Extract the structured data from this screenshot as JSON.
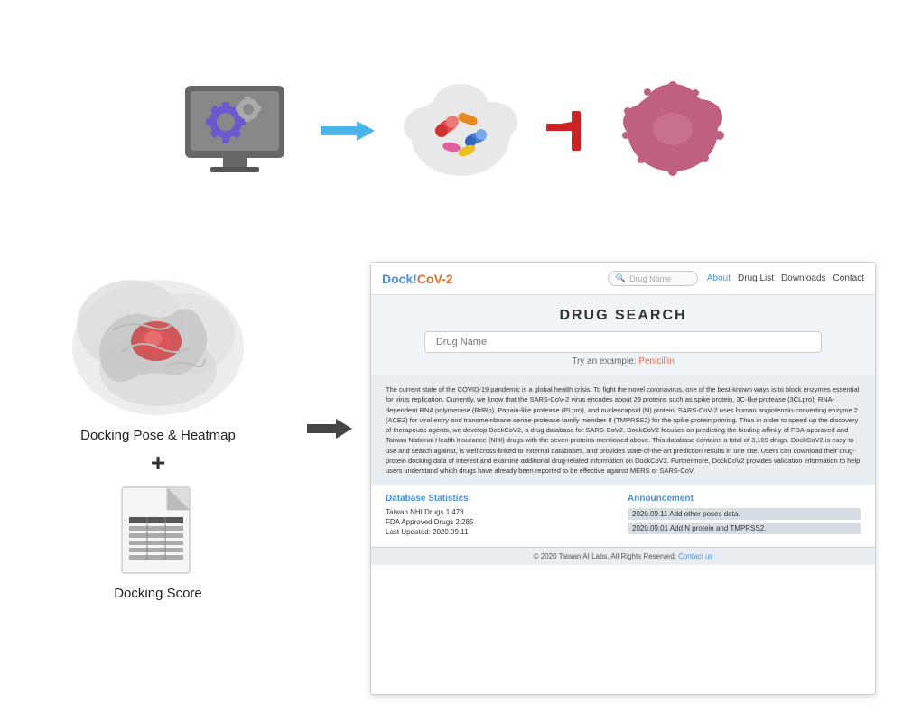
{
  "top": {
    "monitor_label": "Computer with gears",
    "pills_label": "Drug pills cloud",
    "virus_label": "Virus cloud",
    "arrow_label": "Arrow right",
    "block_label": "Block stop arrow"
  },
  "left_panel": {
    "docking_pose_label": "Docking Pose & Heatmap",
    "plus_sign": "+",
    "docking_score_label": "Docking Score"
  },
  "website": {
    "logo": "DockCoV-2",
    "logo_dock": "Dock",
    "logo_cov": "CoV-2",
    "search_placeholder": "Drug Name",
    "nav_links": [
      "About",
      "Drug List",
      "Downloads",
      "Contact"
    ],
    "drug_search_title": "DRUG SEARCH",
    "search_input_placeholder": "Drug Name",
    "try_example_text": "Try an example:",
    "try_example_link": "Penicillin",
    "description": "The current state of the COVID-19 pandemic is a global health crisis. To fight the novel coronavirus, one of the best-known ways is to block enzymes essential for virus replication. Currently, we know that the SARS-CoV-2 virus encodes about 29 proteins such as spike protein, 3C-like protease (3CLpro), RNA-dependent RNA polymerase (RdRp), Papain-like protease (PLpro), and nucleocapsid (N) protein. SARS-CoV-2 uses human angiotensin-converting enzyme 2 (ACE2) for viral entry and transmembrane serine protease family member II (TMPRSS2) for the spike protein priming. Thus in order to speed up the discovery of therapeutic agents, we develop DockCoV2, a drug database for SARS-CoV2. DockCoV2 focuses on predicting the binding affinity of FDA-approved and Taiwan National Health Insurance (NHI) drugs with the seven proteins mentioned above. This database contains a total of 3,109 drugs. DockCoV2 is easy to use and search against, is well cross-linked to external databases, and provides state-of-the-art prediction results in one site. Users can download their drug-protein docking data of interest and examine additional drug-related information on DockCoV2. Furthermore, DockCoV2 provides validation information to help users understand which drugs have already been reported to be effective against MERS or SARS-CoV.",
    "stats_title": "Database Statistics",
    "stats_items": [
      "Taiwan NHI Drugs 1,478",
      "FDA Approved Drugs 2,285",
      "Last Updated: 2020.09.11"
    ],
    "announce_title": "Announcement",
    "announce_items": [
      "2020.09.11 Add other poses data.",
      "2020.09.01 Add N protein and TMPRSS2."
    ],
    "footer": "© 2020 Taiwan AI Labs, All Rights Reserved.",
    "footer_link": "Contact us"
  }
}
